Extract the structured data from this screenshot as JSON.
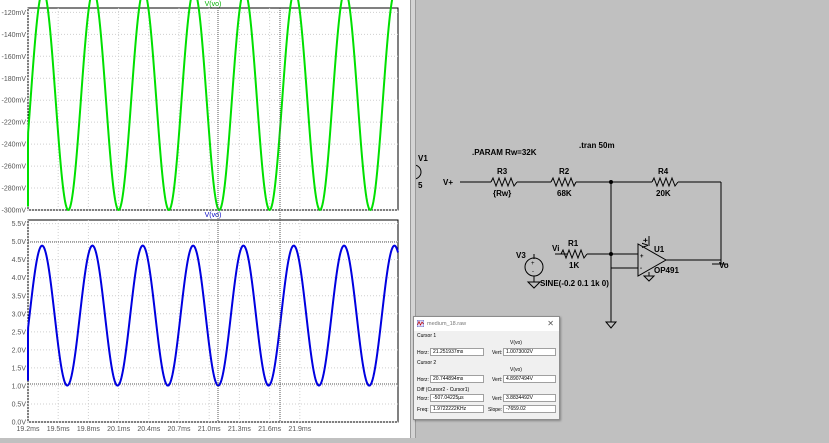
{
  "plot_top": {
    "trace_label": "V(vo)",
    "trace_color": "#00e000",
    "y_ticks": [
      "-120mV",
      "-140mV",
      "-160mV",
      "-180mV",
      "-200mV",
      "-220mV",
      "-240mV",
      "-260mV",
      "-280mV",
      "-300mV"
    ]
  },
  "plot_bottom": {
    "trace_label": "V(vo)",
    "trace_color": "#0000e0",
    "y_ticks": [
      "5.5V",
      "5.0V",
      "4.5V",
      "4.0V",
      "3.5V",
      "3.0V",
      "2.5V",
      "2.0V",
      "1.5V",
      "1.0V",
      "0.5V",
      "0.0V"
    ],
    "x_ticks": [
      "19.2ms",
      "19.5ms",
      "19.8ms",
      "20.1ms",
      "20.4ms",
      "20.7ms",
      "21.0ms",
      "21.3ms",
      "21.6ms",
      "21.9ms"
    ]
  },
  "schematic": {
    "param": ".PARAM Rw=32K",
    "tran": ".tran 50m",
    "v1_name": "V1",
    "v1_value": "5",
    "vplus_label": "V+",
    "r3_name": "R3",
    "r3_value": "{Rw}",
    "r2_name": "R2",
    "r2_value": "68K",
    "r4_name": "R4",
    "r4_value": "20K",
    "v3_name": "V3",
    "vi_label": "Vi",
    "r1_name": "R1",
    "r1_value": "1K",
    "opamp_vplus": "V+",
    "u1_name": "U1",
    "u1_model": "OP491",
    "vo_label": "Vo",
    "sine": "SINE(-0.2 0.1 1k 0)"
  },
  "cursor_dialog": {
    "title": "medium_18.raw",
    "close": "✕",
    "cursor1_label": "Cursor 1",
    "cursor1_trace": "V(vo)",
    "cursor1_horz_label": "Horz:",
    "cursor1_horz": "21.251937ms",
    "cursor1_vert_label": "Vert:",
    "cursor1_vert": "1.0073002V",
    "cursor2_label": "Cursor 2",
    "cursor2_trace": "V(vo)",
    "cursor2_horz_label": "Horz:",
    "cursor2_horz": "20.744894ms",
    "cursor2_vert_label": "Vert:",
    "cursor2_vert": "4.8907494V",
    "diff_label": "Diff (Cursor2 - Cursor1)",
    "diff_horz_label": "Horz:",
    "diff_horz": "-507.04225µs",
    "diff_vert_label": "Vert:",
    "diff_vert": "3.8834492V",
    "freq_label": "Freq:",
    "freq": "1.9722222KHz",
    "slope_label": "Slope:",
    "slope": "-7659.02"
  }
}
